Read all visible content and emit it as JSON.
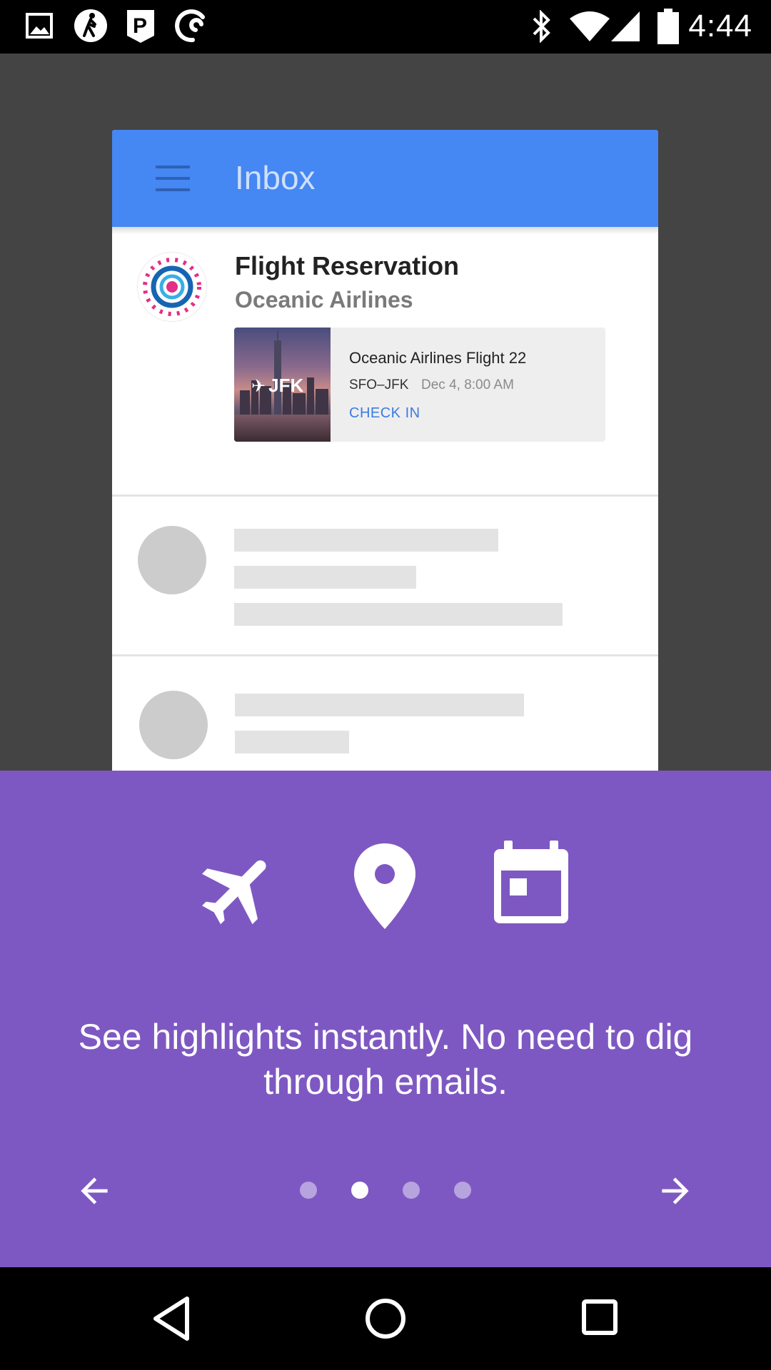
{
  "status_bar": {
    "time": "4:44",
    "left_icons": [
      "gallery-icon",
      "walk-icon",
      "parking-icon",
      "sync-icon"
    ],
    "right_icons": [
      "bluetooth-icon",
      "wifi-icon",
      "signal-icon",
      "battery-icon"
    ]
  },
  "inbox_preview": {
    "header_title": "Inbox",
    "header_color": "#4587f3",
    "message": {
      "title": "Flight Reservation",
      "sender": "Oceanic Airlines",
      "flight": {
        "image_label": "JFK",
        "name": "Oceanic Airlines Flight 22",
        "route": "SFO–JFK",
        "date": "Dec 4, 8:00 AM",
        "action": "CHECK IN"
      }
    }
  },
  "onboarding": {
    "background": "#7e58c2",
    "feature_icons": [
      "airplane-icon",
      "location-pin-icon",
      "calendar-icon"
    ],
    "caption": "See highlights instantly. No need to dig through emails.",
    "pager": {
      "total": 4,
      "current": 2
    },
    "prev_icon": "arrow-back-icon",
    "next_icon": "arrow-forward-icon"
  },
  "nav_bar": {
    "icons": [
      "back-icon",
      "home-icon",
      "recents-icon"
    ]
  }
}
